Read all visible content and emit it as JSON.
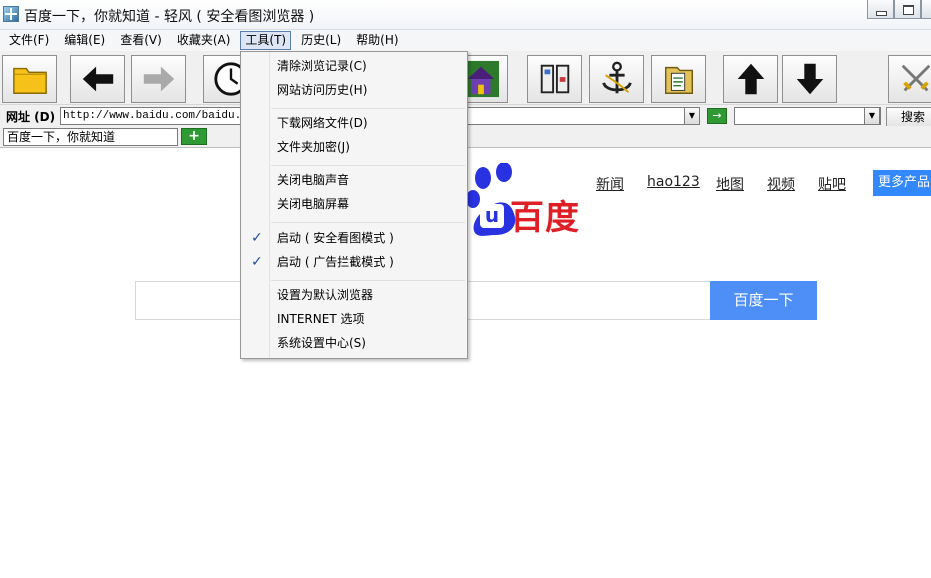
{
  "window": {
    "title": "百度一下，你就知道 - 轻风 ( 安全看图浏览器 )"
  },
  "menubar": {
    "items": [
      {
        "label": "文件(F)"
      },
      {
        "label": "编辑(E)"
      },
      {
        "label": "查看(V)"
      },
      {
        "label": "收藏夹(A)"
      },
      {
        "label": "工具(T)"
      },
      {
        "label": "历史(L)"
      },
      {
        "label": "帮助(H)"
      }
    ]
  },
  "toolbar": {
    "icons": [
      "folder-icon",
      "back-arrow-icon",
      "forward-arrow-icon",
      "clock-icon",
      "house-icon",
      "panels-icon",
      "anchor-icon",
      "documents-icon",
      "up-arrow-icon",
      "down-arrow-icon",
      "crossed-swords-icon"
    ]
  },
  "address": {
    "label": "网址 (D)",
    "url": "http://www.baidu.com/baidu.h",
    "go_label": "→",
    "search_label": "搜索"
  },
  "favbar": {
    "value": "百度一下，你就知道",
    "add_label": "+"
  },
  "page": {
    "logo_text": "百度",
    "logo_badge": "u",
    "nav": [
      "新闻",
      "hao123",
      "地图",
      "视频",
      "贴吧"
    ],
    "more_label": "更多产品",
    "search_button": "百度一下"
  },
  "tools_menu": {
    "groups": [
      [
        {
          "label": "清除浏览记录(C)"
        },
        {
          "label": "网站访问历史(H)"
        }
      ],
      [
        {
          "label": "下载网络文件(D)"
        },
        {
          "label": "文件夹加密(J)"
        }
      ],
      [
        {
          "label": "关闭电脑声音"
        },
        {
          "label": "关闭电脑屏幕"
        }
      ],
      [
        {
          "label": "启动 ( 安全看图模式 )",
          "checked": true
        },
        {
          "label": "启动 ( 广告拦截模式 )",
          "checked": true
        }
      ],
      [
        {
          "label": "设置为默认浏览器"
        },
        {
          "label": "INTERNET 选项"
        },
        {
          "label": "系统设置中心(S)"
        }
      ]
    ],
    "check_glyph": "✓"
  },
  "colors": {
    "baidu_red": "#de1f26",
    "baidu_blue": "#2932e1",
    "accent_blue": "#4e8ef7"
  }
}
